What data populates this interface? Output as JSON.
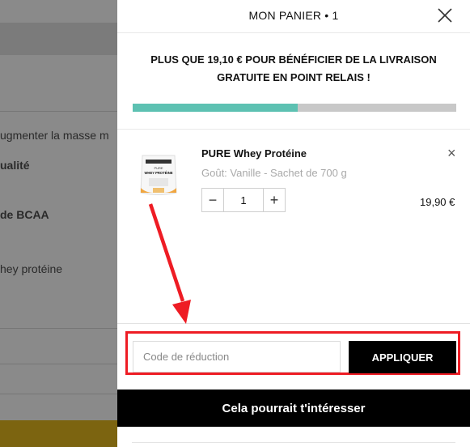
{
  "background": {
    "lines": [
      {
        "text": "ugmenter la masse m",
        "bold": false
      },
      {
        "text": "ualité",
        "bold": true
      },
      {
        "text": "de BCAA",
        "bold": true
      },
      {
        "text": "hey protéine",
        "bold": false
      }
    ]
  },
  "cart": {
    "title": "MON PANIER • 1",
    "shipping_line1": "PLUS QUE 19,10 € POUR BÉNÉFICIER DE LA LIVRAISON",
    "shipping_line2": "GRATUITE EN POINT RELAIS !",
    "progress_fraction": 0.51,
    "colors": {
      "progress": "#5dc1b2",
      "track": "#c8c8c8",
      "highlight": "#ee1c24"
    },
    "item": {
      "name": "PURE Whey Protéine",
      "variant": "Goût: Vanille - Sachet de 700 g",
      "quantity": "1",
      "price": "19,90 €",
      "image_label": "WHEY PROTÉINE",
      "image_brand": "PURE"
    },
    "promo": {
      "placeholder": "Code de réduction",
      "button_label": "APPLIQUER"
    },
    "suggest_label": "Cela pourrait t'intéresser"
  },
  "icons": {
    "close": "close-icon",
    "minus": "minus-icon",
    "plus": "plus-icon",
    "remove": "remove-icon"
  }
}
